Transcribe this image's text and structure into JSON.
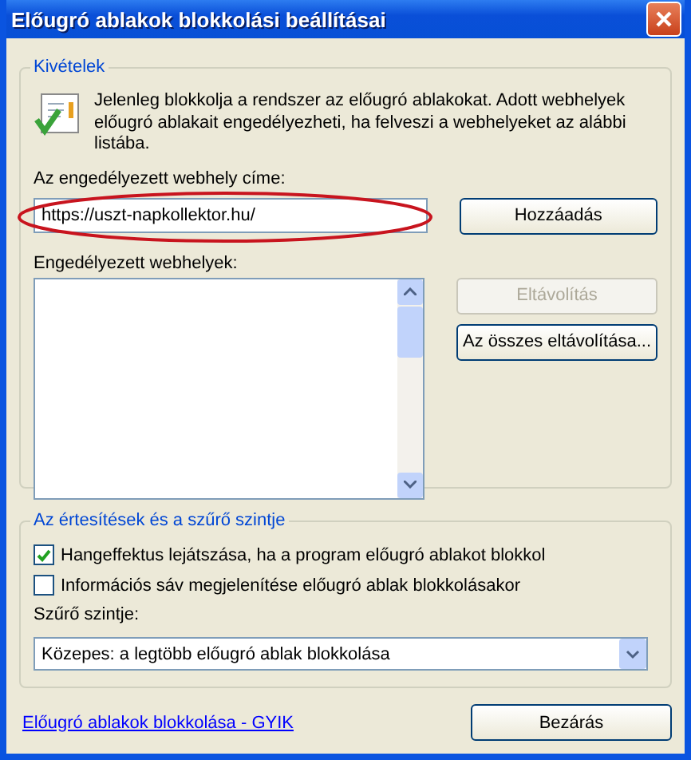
{
  "window": {
    "title": "Előugró ablakok blokkolási beállításai"
  },
  "exceptions": {
    "legend": "Kivételek",
    "message": "Jelenleg blokkolja a rendszer az előugró ablakokat. Adott webhelyek előugró ablakait engedélyezheti, ha felveszi a webhelyeket az alábbi listába.",
    "address_label": "Az engedélyezett webhely címe:",
    "address_value": "https://uszt-napkollektor.hu/",
    "add_button": {
      "label": "Hozzáadás",
      "disabled": false
    },
    "list_label": "Engedélyezett webhelyek:",
    "list_buttons": [
      {
        "label": "Eltávolítás",
        "disabled": true
      },
      {
        "label": "Az összes eltávolítása...",
        "disabled": false
      }
    ]
  },
  "notifications": {
    "legend": "Az értesítések és a szűrő szintje",
    "options": [
      {
        "label": "Hangeffektus lejátszása, ha a program előugró ablakot blokkol",
        "checked": true
      },
      {
        "label": "Információs sáv megjelenítése előugró ablak blokkolásakor",
        "checked": false
      }
    ],
    "filter_label": "Szűrő szintje:",
    "filter_value": "Közepes: a legtöbb előugró ablak blokkolása"
  },
  "footer": {
    "link": "Előugró ablakok blokkolása - GYIK",
    "close_button": "Bezárás"
  }
}
